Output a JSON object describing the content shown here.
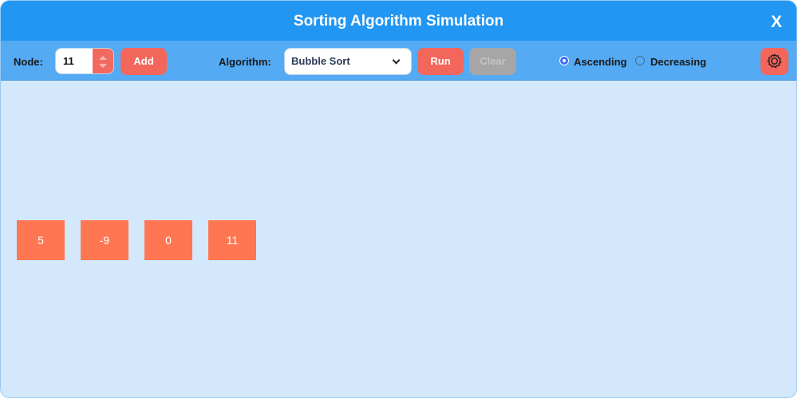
{
  "window": {
    "title": "Sorting Algorithm Simulation",
    "close_label": "X"
  },
  "toolbar": {
    "node_label": "Node:",
    "node_value": "11",
    "add_label": "Add",
    "algorithm_label": "Algorithm:",
    "algorithm_selected": "Bubble Sort",
    "run_label": "Run",
    "clear_label": "Clear",
    "clear_enabled": false,
    "order_options": [
      {
        "label": "Ascending",
        "selected": true
      },
      {
        "label": "Decreasing",
        "selected": false
      }
    ],
    "settings_icon": "gear-icon"
  },
  "nodes": [
    "5",
    "-9",
    "0",
    "11"
  ],
  "colors": {
    "title_bar": "#2196f3",
    "toolbar": "#54aaf3",
    "canvas": "#d3e8fb",
    "accent_button": "#f2665c",
    "node_fill": "#ff7752",
    "disabled_button": "#a6a6a6"
  }
}
